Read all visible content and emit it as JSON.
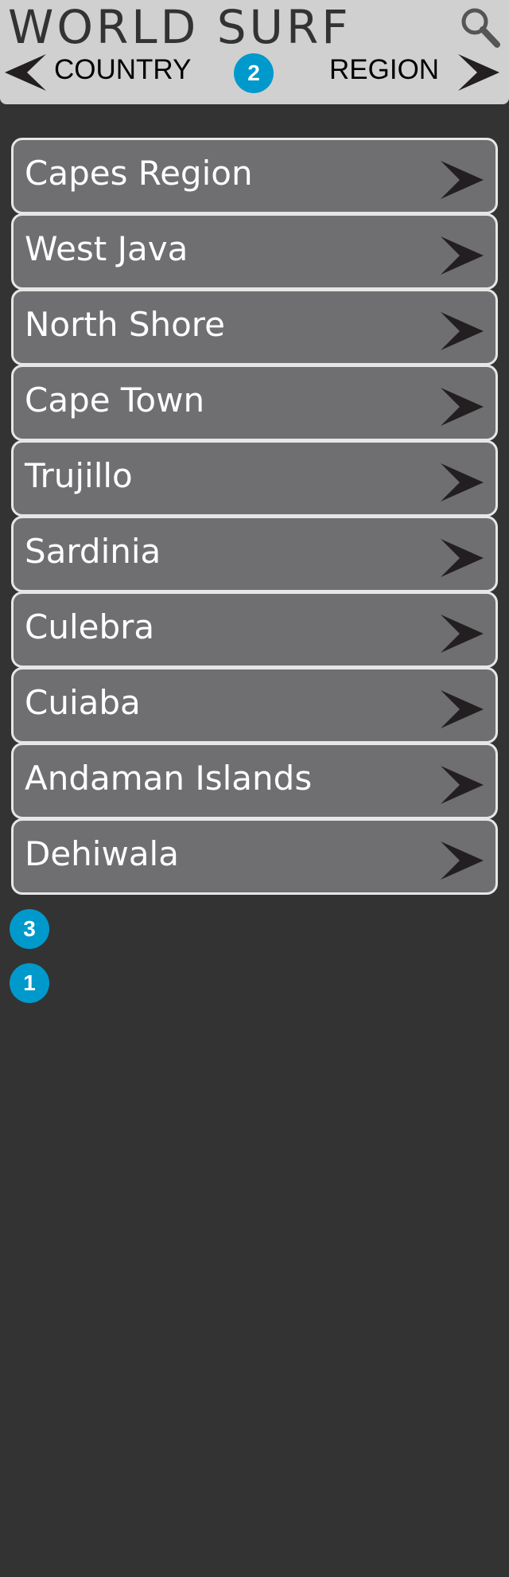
{
  "header": {
    "title": "WORLD SURF",
    "search_icon": "search-icon",
    "prev_icon": "chevron-left-icon",
    "next_icon": "chevron-right-icon",
    "country_label": "COUNTRY",
    "region_label": "REGION",
    "badge": "2"
  },
  "regions": [
    {
      "label": "Capes Region"
    },
    {
      "label": "West Java"
    },
    {
      "label": "North Shore"
    },
    {
      "label": "Cape Town"
    },
    {
      "label": "Trujillo"
    },
    {
      "label": "Sardinia"
    },
    {
      "label": "Culebra"
    },
    {
      "label": "Cuiaba"
    },
    {
      "label": "Andaman Islands"
    },
    {
      "label": "Dehiwala"
    }
  ],
  "annotations": {
    "badge_a": "3",
    "badge_b": "1"
  },
  "colors": {
    "background": "#333333",
    "header_bg": "#d0d0d0",
    "item_bg": "#6f6f72",
    "item_border": "#e6e6e6",
    "badge": "#0099cc",
    "arrow": "#231f20"
  }
}
